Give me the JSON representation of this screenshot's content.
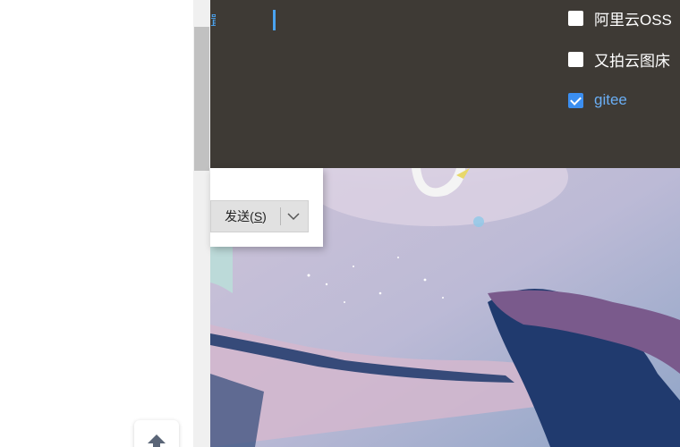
{
  "header": {
    "partial_link_text": "置"
  },
  "upload_targets": [
    {
      "label": "阿里云OSS",
      "checked": false
    },
    {
      "label": "又拍云图床",
      "checked": false
    },
    {
      "label": "gitee",
      "checked": true
    }
  ],
  "send_button": {
    "label": "发送(",
    "accel": "S",
    "close": ")"
  },
  "icons": {
    "dropdown": "chevron-down-icon",
    "back_to_top": "arrow-up-icon"
  },
  "colors": {
    "header_bg": "#3e3a35",
    "accent": "#4aa3f0",
    "checked_box": "#3b8ef0"
  }
}
